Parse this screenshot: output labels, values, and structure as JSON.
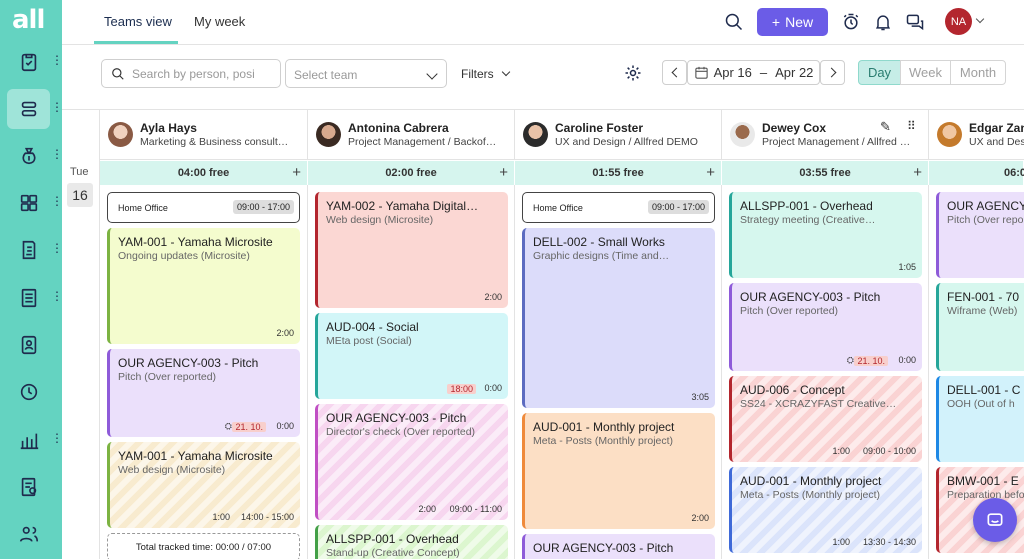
{
  "app": {
    "logo": "all"
  },
  "topbar": {
    "tabs": [
      {
        "label": "Teams view"
      },
      {
        "label": "My week"
      }
    ],
    "new_label": "New",
    "user_initials": "NA"
  },
  "toolbar": {
    "search_placeholder": "Search by person, posi",
    "team_placeholder": "Select team",
    "filters_label": "Filters",
    "date_start": "Apr 16",
    "date_sep": "–",
    "date_end": "Apr 22",
    "views": [
      "Day",
      "Week",
      "Month"
    ],
    "active_view": "Day"
  },
  "day": {
    "weekday": "Tue",
    "number": "16"
  },
  "people": [
    {
      "name": "Ayla Hays",
      "role": "Marketing & Business consult…",
      "free": "04:00 free"
    },
    {
      "name": "Antonina Cabrera",
      "role": "Project Management / Backof…",
      "free": "02:00 free"
    },
    {
      "name": "Caroline Foster",
      "role": "UX and Design / Allfred DEMO",
      "free": "01:55 free"
    },
    {
      "name": "Dewey Cox",
      "role": "Project Management / Allfred …",
      "free": "03:55 free"
    },
    {
      "name": "Edgar Zan",
      "role": "UX and Des",
      "free": "06:0"
    }
  ],
  "columns": [
    {
      "home": {
        "title": "Home Office",
        "time": "09:00 - 17:00"
      },
      "cards": [
        {
          "title": "YAM-001 - Yamaha Microsite",
          "sub": "Ongoing updates (Microsite)",
          "duration": "2:00"
        },
        {
          "title": "OUR AGENCY-003 - Pitch",
          "sub": "Pitch (Over reported)",
          "deadline": "21. 10.",
          "duration": "0:00"
        },
        {
          "title": "YAM-001 - Yamaha Microsite",
          "sub": "Web design (Microsite)",
          "duration": "1:00",
          "time": "14:00 - 15:00"
        }
      ],
      "total": "Total tracked time: 00:00 / 07:00"
    },
    {
      "cards": [
        {
          "title": "YAM-002 - Yamaha Digital…",
          "sub": "Web design (Microsite)",
          "duration": "2:00"
        },
        {
          "title": "AUD-004 - Social",
          "sub": "MEta post (Social)",
          "deadline": "18:00",
          "duration": "0:00"
        },
        {
          "title": "OUR AGENCY-003 - Pitch",
          "sub": "Director's check (Over reported)",
          "duration": "2:00",
          "time": "09:00 - 11:00"
        },
        {
          "title": "ALLSPP-001 - Overhead",
          "sub": "Stand-up (Creative Concept)"
        }
      ]
    },
    {
      "home": {
        "title": "Home Office",
        "time": "09:00 - 17:00"
      },
      "cards": [
        {
          "title": "DELL-002 - Small Works",
          "sub": "Graphic designs (Time and…",
          "duration": "3:05"
        },
        {
          "title": "AUD-001 - Monthly project",
          "sub": "Meta - Posts (Monthly project)",
          "duration": "2:00"
        },
        {
          "title": "OUR AGENCY-003 - Pitch",
          "sub": ""
        }
      ]
    },
    {
      "cards": [
        {
          "title": "ALLSPP-001 - Overhead",
          "sub": "Strategy meeting (Creative…",
          "duration": "1:05"
        },
        {
          "title": "OUR AGENCY-003 - Pitch",
          "sub": "Pitch (Over reported)",
          "deadline": "21. 10.",
          "duration": "0:00"
        },
        {
          "title": "AUD-006 - Concept",
          "sub": "SS24 - XCRAZYFAST Creative…",
          "duration": "1:00",
          "time": "09:00 - 10:00"
        },
        {
          "title": "AUD-001 - Monthly project",
          "sub": "Meta - Posts (Monthly project)",
          "duration": "1:00",
          "time": "13:30 - 14:30"
        }
      ]
    },
    {
      "cards": [
        {
          "title": "OUR AGENCY",
          "sub": "Pitch (Over repo"
        },
        {
          "title": "FEN-001 - 70",
          "sub": "Wiframe (Web)"
        },
        {
          "title": "DELL-001 - C",
          "sub": "OOH (Out of h"
        },
        {
          "title": "BMW-001 - E",
          "sub": "Preparation befo"
        }
      ]
    }
  ]
}
